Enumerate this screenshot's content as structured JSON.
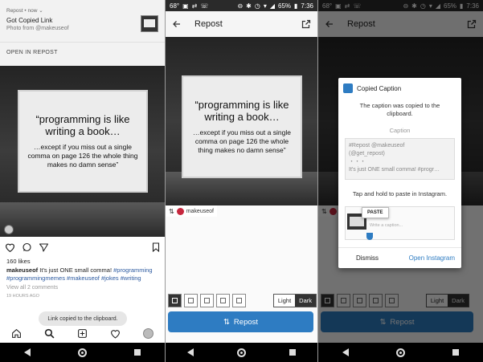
{
  "status": {
    "temp": "68°",
    "battery": "65%",
    "time": "7:36"
  },
  "notification": {
    "header": "Repost • now ⌄",
    "title": "Got Copied Link",
    "subtitle": "Photo from @makeuseof",
    "action": "OPEN IN REPOST"
  },
  "quote": {
    "line1": "“programming is like writing a book…",
    "line2": "…except if you miss out a single comma on page 126 the whole thing makes no damn sense”"
  },
  "instagram": {
    "likes": "160 likes",
    "username": "makeuseof",
    "caption_text": " It's just ONE small comma! ",
    "hashtags": "#programming #programmingmemes #makeuseof #jokes #writing",
    "comments": "View all 2 comments",
    "time_ago": "19 HOURS AGO",
    "toast": "Link copied to the clipboard."
  },
  "repost": {
    "title": "Repost",
    "attribution_user": "makeuseof",
    "light_label": "Light",
    "dark_label": "Dark",
    "button_label": "Repost"
  },
  "dialog": {
    "title": "Copied Caption",
    "message": "The caption was copied to the clipboard.",
    "caption_label": "Caption",
    "caption_lines": [
      "#Repost @makeuseof",
      "(@get_repost)",
      "・・・",
      "It's just ONE small comma! #progr…"
    ],
    "tap_hint": "Tap and hold to paste in Instagram.",
    "paste_label": "PASTE",
    "write_caption": "Write a caption...",
    "dismiss": "Dismiss",
    "open_instagram": "Open Instagram"
  },
  "colors": {
    "accent": "#2e7cc2",
    "hashtag": "#2c5aa0",
    "instagram_badge": "#c6273d"
  }
}
